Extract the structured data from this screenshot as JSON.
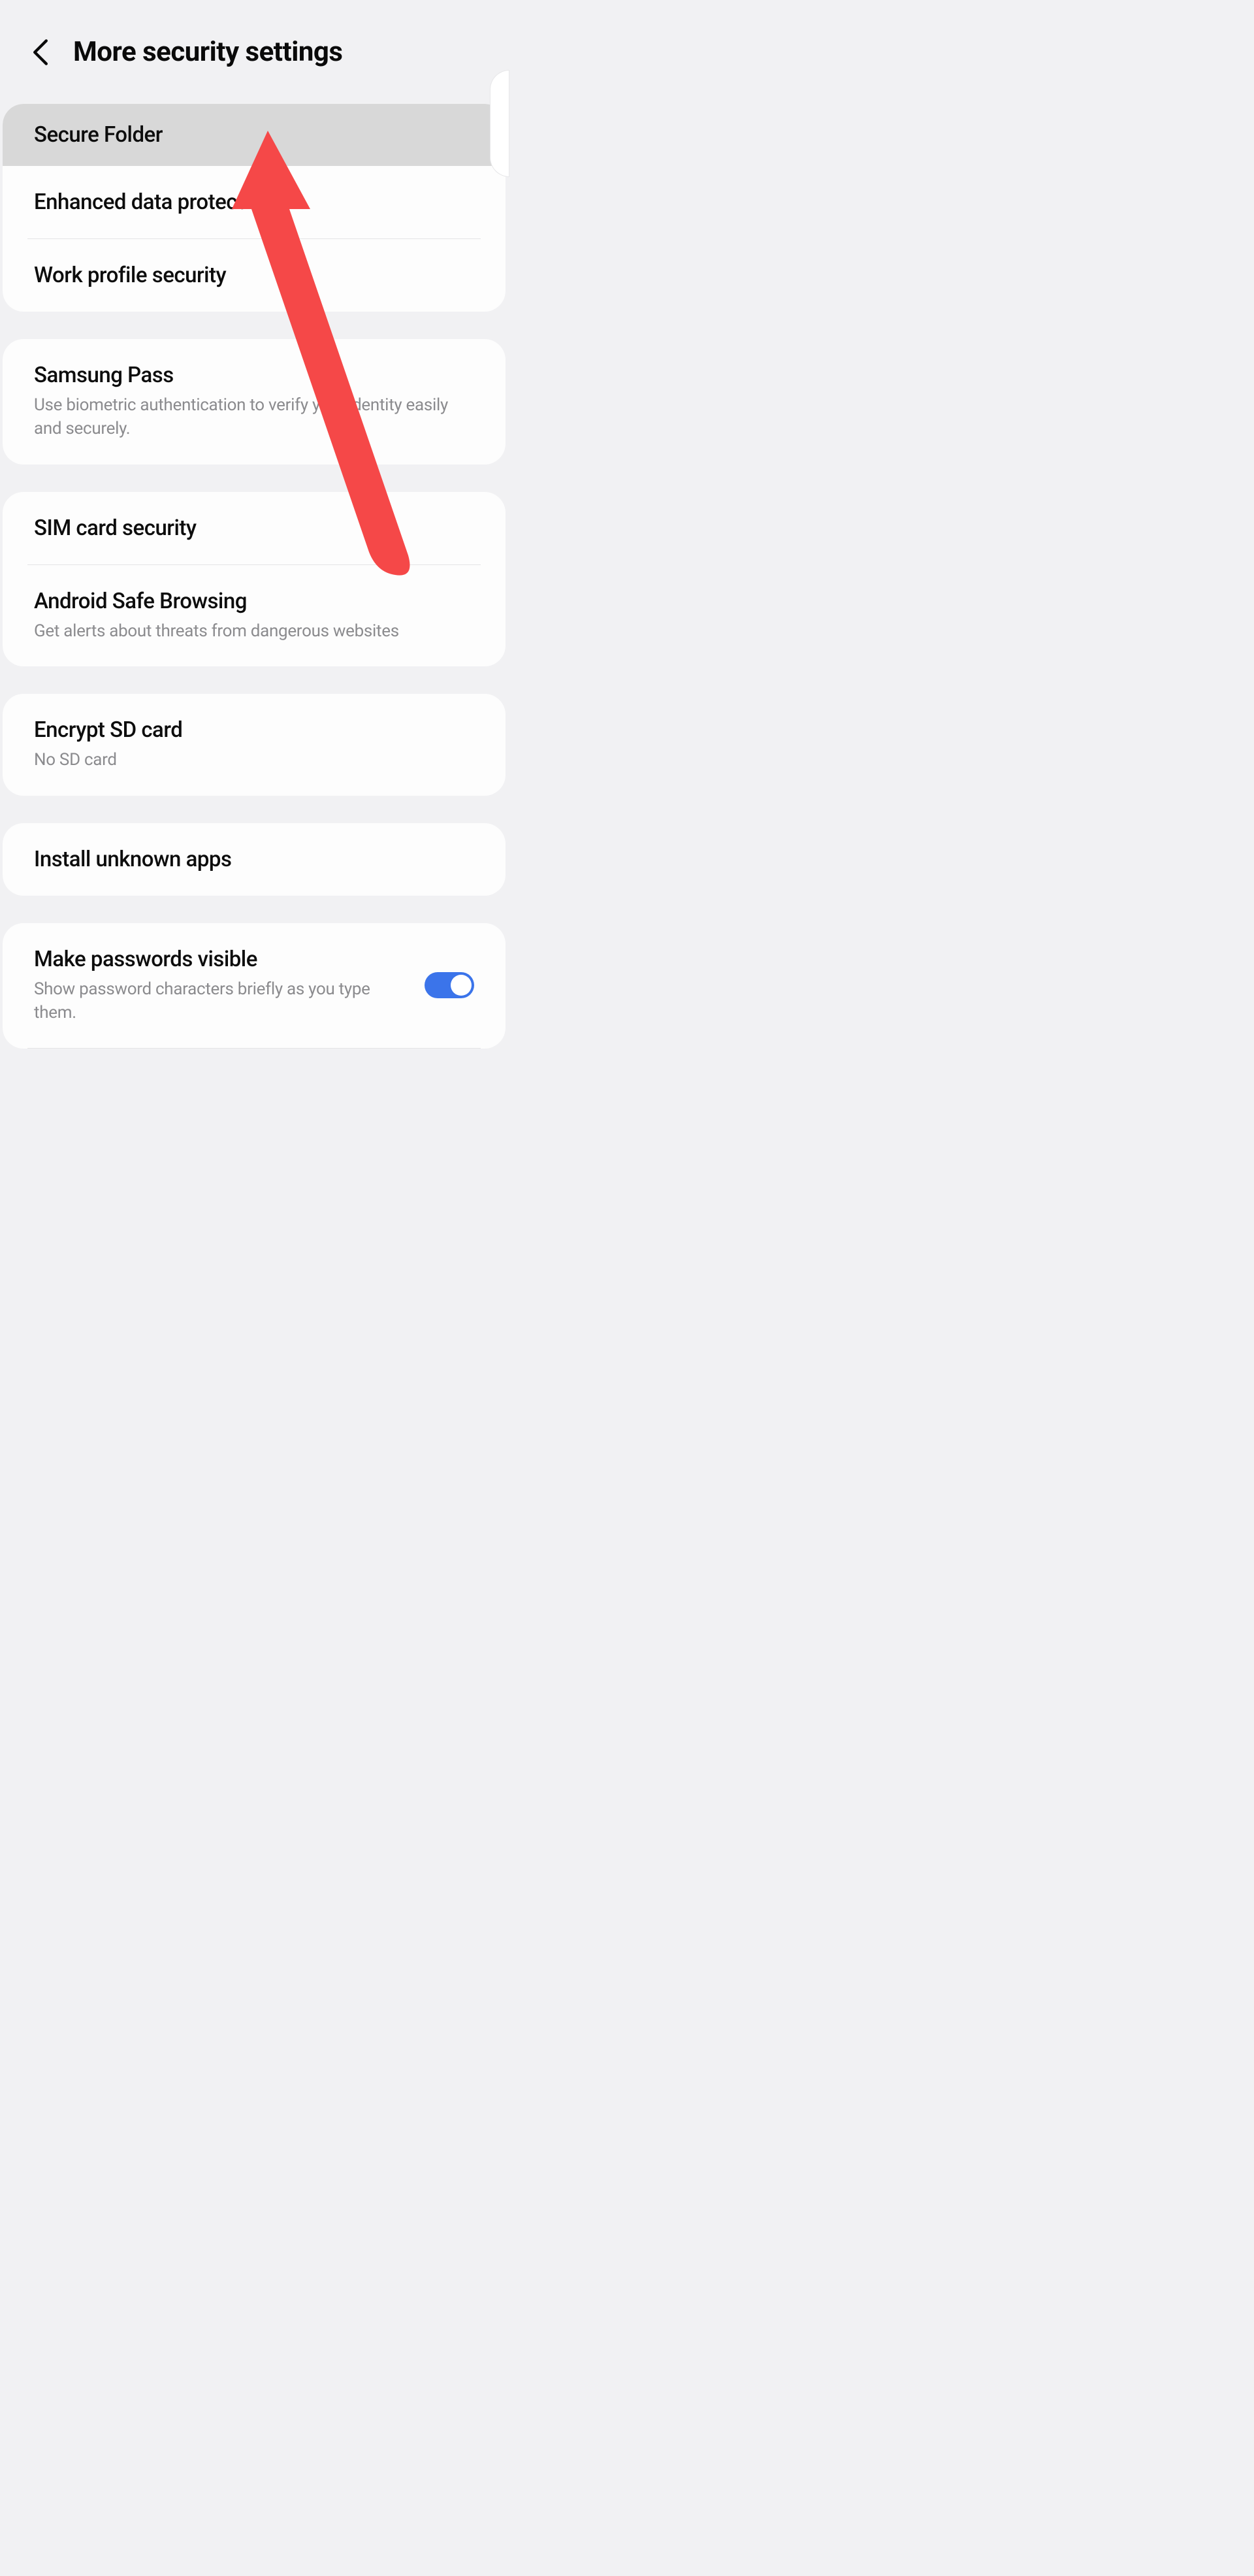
{
  "header": {
    "title": "More security settings"
  },
  "groups": [
    {
      "items": [
        {
          "title": "Secure Folder",
          "highlighted": true
        },
        {
          "title": "Enhanced data protection"
        },
        {
          "title": "Work profile security"
        }
      ]
    },
    {
      "items": [
        {
          "title": "Samsung Pass",
          "sub": "Use biometric authentication to verify your identity easily and securely."
        }
      ]
    },
    {
      "items": [
        {
          "title": "SIM card security"
        },
        {
          "title": "Android Safe Browsing",
          "sub": "Get alerts about threats from dangerous websites"
        }
      ]
    },
    {
      "items": [
        {
          "title": "Encrypt SD card",
          "sub": "No SD card"
        }
      ]
    },
    {
      "items": [
        {
          "title": "Install unknown apps"
        }
      ]
    },
    {
      "items": [
        {
          "title": "Make passwords visible",
          "sub": "Show password characters briefly as you type them.",
          "toggle": true
        }
      ]
    }
  ],
  "annotation": {
    "arrow_color": "#f54848"
  }
}
